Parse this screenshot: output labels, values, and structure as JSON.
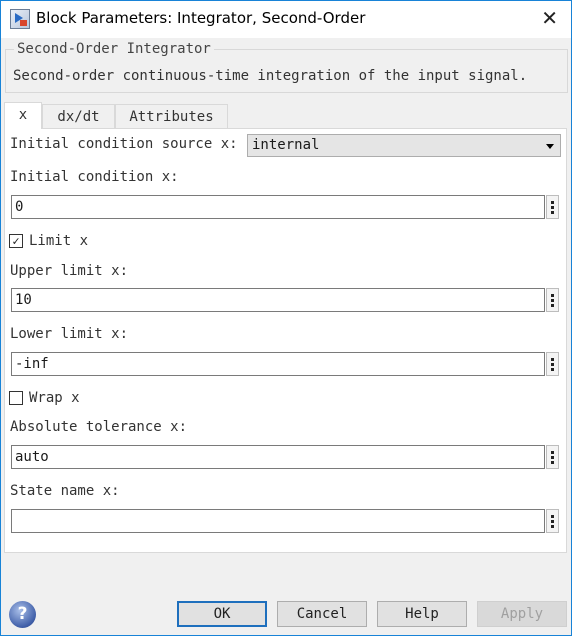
{
  "window": {
    "title": "Block Parameters: Integrator, Second-Order",
    "close_icon": "close-icon"
  },
  "group": {
    "label": "Second-Order Integrator",
    "description": "Second-order continuous-time integration of the input signal."
  },
  "tabs": [
    {
      "label": "x",
      "active": true
    },
    {
      "label": "dx/dt"
    },
    {
      "label": "Attributes"
    }
  ],
  "form": {
    "ic_source_label": "Initial condition source x:",
    "ic_source_value": "internal",
    "ic_label": "Initial condition x:",
    "ic_value": "0",
    "limit_label": "Limit x",
    "limit_checked": true,
    "limit_check_glyph": "✓",
    "upper_label": "Upper limit x:",
    "upper_value": "10",
    "lower_label": "Lower limit x:",
    "lower_value": "-inf",
    "wrap_label": "Wrap x",
    "wrap_checked": false,
    "abstol_label": "Absolute tolerance x:",
    "abstol_value": "auto",
    "state_label": "State name x:",
    "state_value": ""
  },
  "buttons": {
    "ok": "OK",
    "cancel": "Cancel",
    "help": "Help",
    "apply": "Apply",
    "help_glyph": "?"
  },
  "colors": {
    "accent": "#1883d7"
  }
}
